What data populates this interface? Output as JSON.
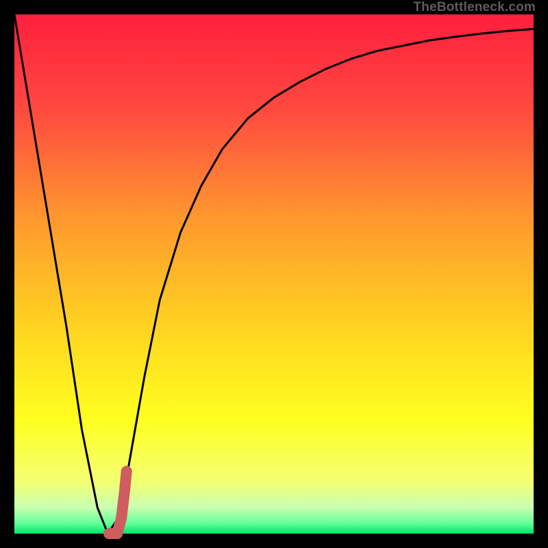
{
  "watermark": "TheBottleneck.com",
  "colors": {
    "frame": "#000000",
    "curve": "#000000",
    "marker": "#cd5d5f",
    "gradient_stops": [
      {
        "pct": 0,
        "color": "#ff1f3e"
      },
      {
        "pct": 18,
        "color": "#ff4840"
      },
      {
        "pct": 40,
        "color": "#ff9a2e"
      },
      {
        "pct": 60,
        "color": "#ffd321"
      },
      {
        "pct": 78,
        "color": "#ffff1f"
      },
      {
        "pct": 90,
        "color": "#f3ff73"
      },
      {
        "pct": 95,
        "color": "#c9ffb1"
      },
      {
        "pct": 98,
        "color": "#63ff9a"
      },
      {
        "pct": 100,
        "color": "#00e66b"
      }
    ]
  },
  "chart_data": {
    "type": "line",
    "title": "",
    "xlabel": "",
    "ylabel": "",
    "xlim": [
      0,
      100
    ],
    "ylim": [
      0,
      100
    ],
    "series": [
      {
        "name": "bottleneck-curve",
        "x": [
          0,
          5,
          10,
          13,
          16,
          18,
          20,
          22,
          25,
          28,
          32,
          36,
          40,
          45,
          50,
          55,
          60,
          65,
          70,
          75,
          80,
          85,
          90,
          95,
          100
        ],
        "values": [
          100,
          70,
          40,
          20,
          5,
          0,
          3,
          13,
          30,
          45,
          58,
          67,
          74,
          80,
          84,
          87,
          89.5,
          91.5,
          93,
          94,
          95,
          95.7,
          96.3,
          96.8,
          97.2
        ]
      }
    ],
    "marker": {
      "name": "selected-point",
      "points": [
        {
          "x": 18.2,
          "y": 0
        },
        {
          "x": 19.8,
          "y": 0
        },
        {
          "x": 20.6,
          "y": 3
        },
        {
          "x": 21.2,
          "y": 8
        },
        {
          "x": 21.6,
          "y": 12
        }
      ]
    }
  }
}
